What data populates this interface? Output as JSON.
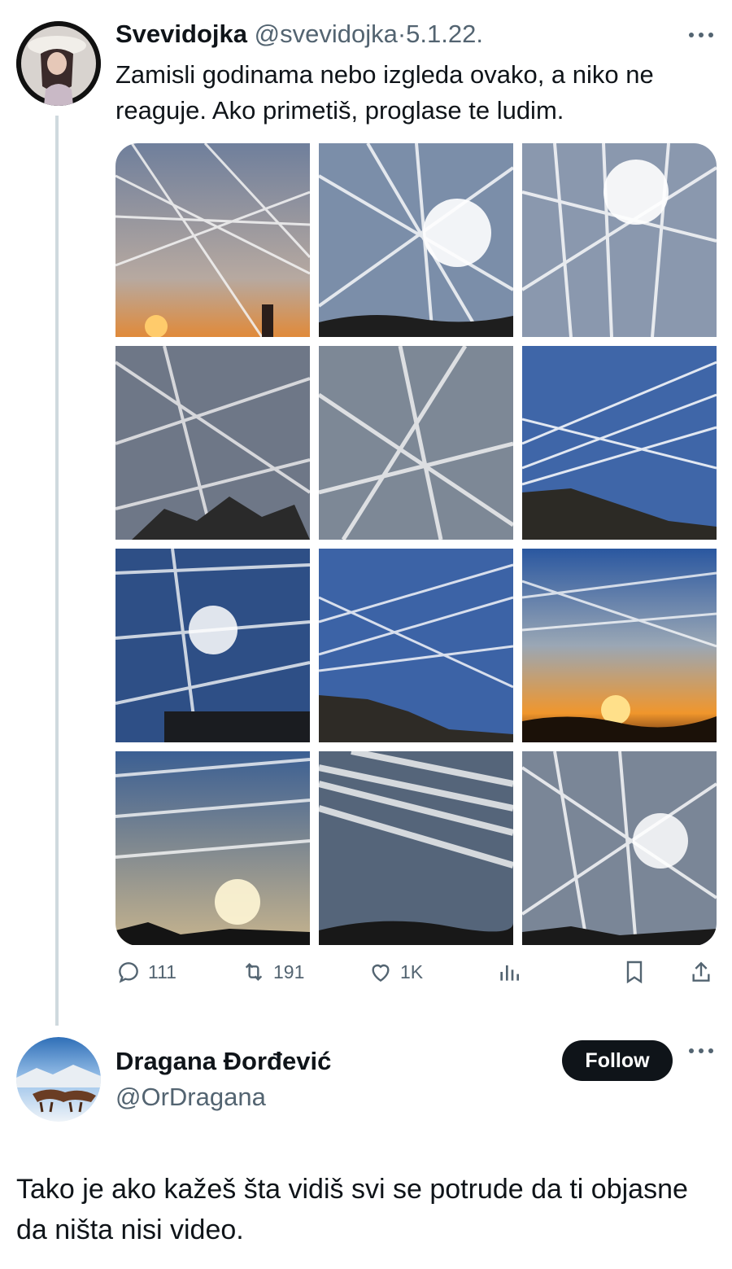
{
  "tweet": {
    "author_name": "Svevidojka",
    "author_handle": "@svevidojka",
    "separator": "·",
    "date": "5.1.22.",
    "more_icon": "more-horizontal-icon",
    "text": "Zamisli godinama nebo izgleda ovako, a niko ne reaguje. Ako primetiš, proglase te ludim.",
    "media": {
      "count": 12,
      "tiles": [
        {
          "scene": "sunset-chimney"
        },
        {
          "scene": "bright-sun-trees"
        },
        {
          "scene": "sun-streaks"
        },
        {
          "scene": "grey-bare-tree"
        },
        {
          "scene": "grey-crossing-trails"
        },
        {
          "scene": "blue-hill"
        },
        {
          "scene": "sun-building"
        },
        {
          "scene": "blue-mountain"
        },
        {
          "scene": "orange-sunset"
        },
        {
          "scene": "blue-low-sun"
        },
        {
          "scene": "parallel-bands"
        },
        {
          "scene": "sun-crosshatch"
        }
      ]
    },
    "actions": {
      "replies": "111",
      "retweets": "191",
      "likes": "1K"
    }
  },
  "reply": {
    "author_name": "Dragana Đorđević",
    "author_handle": "@OrDragana",
    "follow_label": "Follow",
    "more_icon": "more-horizontal-icon",
    "text": "Tako je ako kažeš šta vidiš svi se potrude da ti objasne da ništa nisi video."
  },
  "colors": {
    "text": "#0f1419",
    "muted": "#536471",
    "thread_line": "#cfd9de",
    "follow_bg": "#0f1419"
  }
}
